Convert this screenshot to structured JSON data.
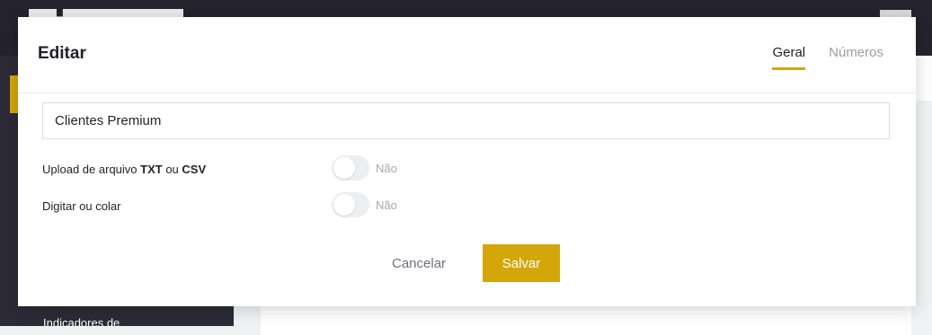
{
  "background": {
    "sidebar_text": "Indicadores de"
  },
  "modal": {
    "title": "Editar",
    "tabs": [
      {
        "label": "Geral",
        "active": true
      },
      {
        "label": "Números",
        "active": false
      }
    ],
    "name_field": {
      "value": "Clientes Premium",
      "placeholder": ""
    },
    "options": [
      {
        "label_prefix": "Upload de arquivo ",
        "label_strong_1": "TXT",
        "label_mid": " ou ",
        "label_strong_2": "CSV",
        "toggle_on": false,
        "toggle_text": "Não"
      },
      {
        "label": "Digitar ou colar",
        "toggle_on": false,
        "toggle_text": "Não"
      }
    ],
    "buttons": {
      "cancel": "Cancelar",
      "save": "Salvar"
    }
  },
  "colors": {
    "accent": "#d4a60a",
    "sidebar": "#2b2a36",
    "topbar": "#24232e"
  }
}
